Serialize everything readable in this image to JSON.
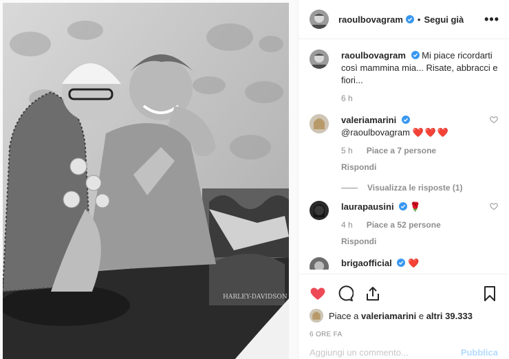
{
  "post": {
    "username": "raoulbovagram",
    "follow_status": "Segui già",
    "more": "•••",
    "caption": "Mi piace ricordarti così mammina mia... Risate, abbracci e fiori...",
    "caption_time": "6 h",
    "likes_user": "valeriamarini",
    "likes_prefix": "Piace a",
    "likes_conj": "e",
    "likes_rest": "altri 39.333",
    "time": "6 ORE FA",
    "add_comment_placeholder": "Aggiungi un commento...",
    "publish_label": "Pubblica"
  },
  "comments": [
    {
      "username": "valeriamarini",
      "mention": "@raoulbovagram",
      "emoji": "❤️❤️❤️",
      "time": "5 h",
      "likes": "Piace a 7 persone",
      "reply_label": "Rispondi",
      "view_replies": "Visualizza le risposte (1)"
    },
    {
      "username": "laurapausini",
      "emoji": "🌹",
      "time": "4 h",
      "likes": "Piace a 52 persone",
      "reply_label": "Rispondi"
    },
    {
      "username": "brigaofficial",
      "emoji": "❤️"
    }
  ],
  "photo": {
    "bike_text": "HARLEY-DAVIDSON"
  },
  "colors": {
    "like_red": "#ed4956",
    "verified_blue": "#3897f0",
    "muted": "#8e8e8e"
  }
}
